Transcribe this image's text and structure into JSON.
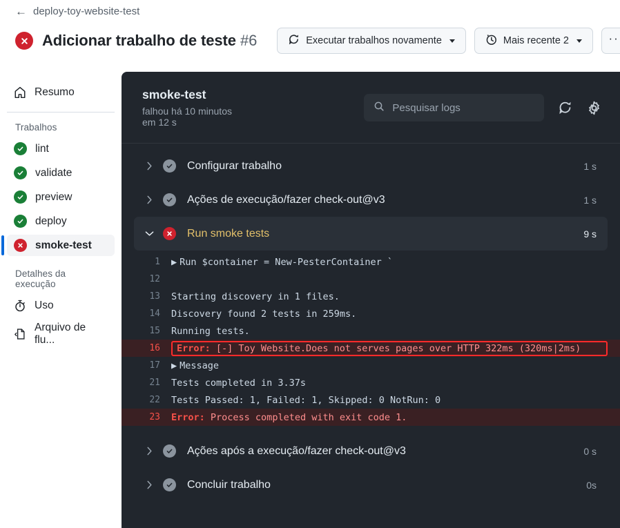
{
  "header": {
    "back_icon": "arrow-left-icon",
    "breadcrumb": "deploy-toy-website-test",
    "status_icon": "x-circle-fail-icon",
    "title": "Adicionar trabalho de teste",
    "run_number": "#6",
    "buttons": [
      {
        "label": "Executar trabalhos novamente",
        "icon": "sync-icon",
        "has_caret": true
      },
      {
        "label": "Mais recente 2",
        "icon": "history-clock-icon",
        "has_caret": true
      }
    ],
    "overflow_label": "···"
  },
  "sidebar": {
    "summary": {
      "label": "Resumo",
      "icon": "home-icon"
    },
    "jobs_label": "Trabalhos",
    "jobs": [
      {
        "label": "lint",
        "status": "success"
      },
      {
        "label": "validate",
        "status": "success"
      },
      {
        "label": "preview",
        "status": "success"
      },
      {
        "label": "deploy",
        "status": "success"
      },
      {
        "label": "smoke-test",
        "status": "failure",
        "selected": true
      }
    ],
    "details_label": "Detalhes da execução",
    "details": [
      {
        "label": "Uso",
        "icon": "stopwatch-icon"
      },
      {
        "label": "Arquivo de flu...",
        "icon": "file-code-icon"
      }
    ]
  },
  "log_panel": {
    "job_name": "smoke-test",
    "job_subtitle": "falhou há 10 minutos em 12 s",
    "search_placeholder": "Pesquisar logs",
    "refresh_icon": "refresh-icon",
    "settings_icon": "gear-icon",
    "steps_top": [
      {
        "label": "Configurar trabalho",
        "time": "1 s",
        "status": "success",
        "expanded": false
      },
      {
        "label": "Ações de execução/fazer check-out@v3",
        "time": "1 s",
        "status": "success",
        "expanded": false
      },
      {
        "label": "Run smoke tests",
        "time": "9 s",
        "status": "failure",
        "expanded": true
      }
    ],
    "log_lines": [
      {
        "num": "1",
        "text": "Run $container = New-PesterContainer `",
        "error": false,
        "arrow": true
      },
      {
        "num": "12",
        "text": "",
        "error": false,
        "arrow": false
      },
      {
        "num": "13",
        "text": "Starting discovery in 1 files.",
        "error": false,
        "arrow": false
      },
      {
        "num": "14",
        "text": "Discovery found 2 tests in 259ms.",
        "error": false,
        "arrow": false
      },
      {
        "num": "15",
        "text": "Running tests.",
        "error": false,
        "arrow": false
      },
      {
        "num": "16",
        "keyword": "Error:",
        "text": " [-] Toy Website.Does not serves pages over HTTP 322ms (320ms|2ms)",
        "error": true,
        "boxed": true,
        "arrow": false
      },
      {
        "num": "17",
        "text": "Message",
        "error": false,
        "arrow": true
      },
      {
        "num": "21",
        "text": "Tests completed in 3.37s",
        "error": false,
        "arrow": false
      },
      {
        "num": "22",
        "text": "Tests Passed: 1, Failed: 1, Skipped: 0 NotRun: 0",
        "error": false,
        "arrow": false
      },
      {
        "num": "23",
        "keyword": "Error:",
        "text": " Process completed with exit code 1.",
        "error": true,
        "boxed": false,
        "arrow": false
      }
    ],
    "steps_bottom": [
      {
        "label": "Ações após a execução/fazer check-out@v3",
        "time": "0 s",
        "status": "success",
        "expanded": false
      },
      {
        "label": "Concluir trabalho",
        "time": "0s",
        "status": "success",
        "expanded": false
      }
    ]
  },
  "colors": {
    "fail_red": "#cf222e",
    "success_green": "#1a7f37",
    "accent_blue": "#0969da",
    "panel_bg": "#21262d",
    "error_line_bg": "#3a2023",
    "error_box_border": "#ff2b2b"
  }
}
